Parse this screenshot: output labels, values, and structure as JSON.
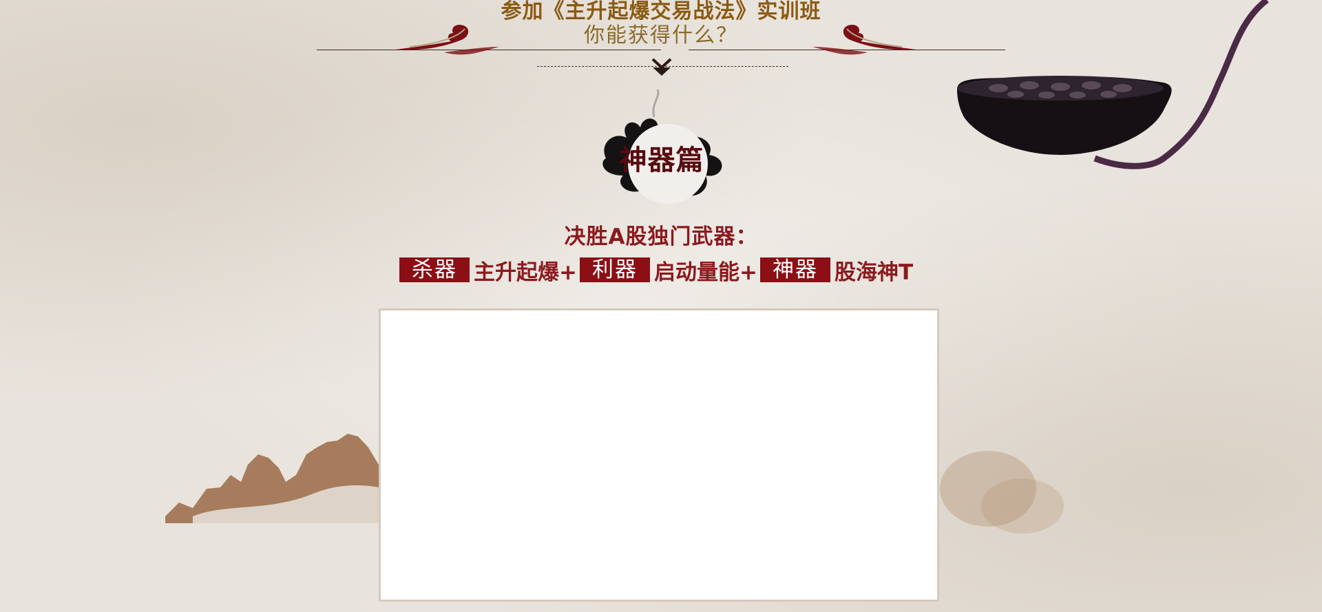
{
  "header": {
    "title": "参加《主升起爆交易战法》实训班",
    "subtitle": "你能获得什么？"
  },
  "seal": {
    "label": "神器篇"
  },
  "section": {
    "heading": "决胜A股独门武器："
  },
  "weapons": [
    {
      "tag": "杀器",
      "text": "主升起爆+"
    },
    {
      "tag": "利器",
      "text": "启动量能+"
    },
    {
      "tag": "神器",
      "text": "股海神T"
    }
  ],
  "colors": {
    "title_gold": "#8a5a12",
    "accent_red": "#8b0f15",
    "background": "#e8e3dc"
  },
  "icons": [
    "cloud-ornament-left-icon",
    "cloud-ornament-right-icon",
    "down-arrow-icon",
    "lotus-pod-icon",
    "ink-mountain-icon"
  ]
}
